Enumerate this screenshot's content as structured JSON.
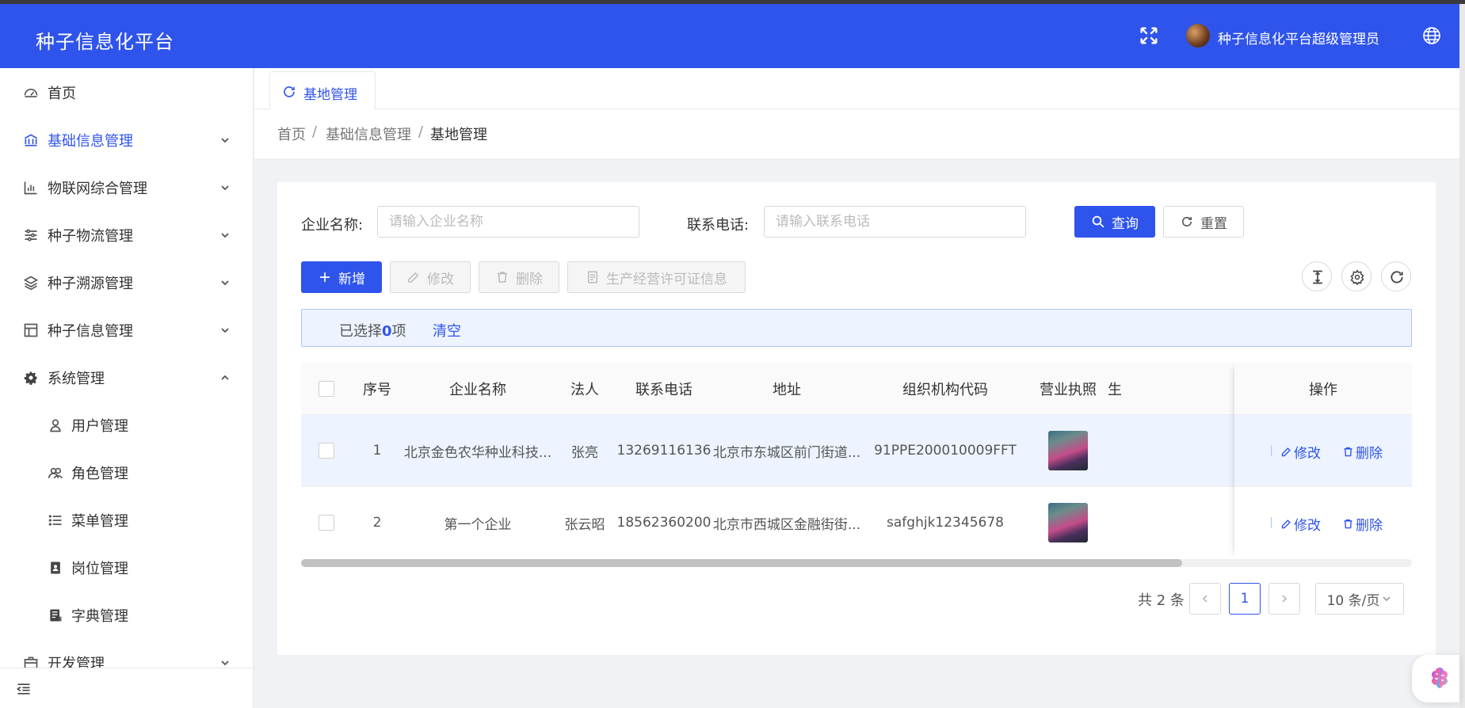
{
  "header": {
    "app_title": "种子信息化平台",
    "user_name": "种子信息化平台超级管理员",
    "icons": [
      "fullscreen-icon",
      "globe-icon"
    ]
  },
  "sidebar": {
    "items": [
      {
        "label": "首页",
        "icon": "dashboard-icon",
        "has_children": false
      },
      {
        "label": "基础信息管理",
        "icon": "bank-icon",
        "has_children": true,
        "active": true
      },
      {
        "label": "物联网综合管理",
        "icon": "bar-chart-icon",
        "has_children": true
      },
      {
        "label": "种子物流管理",
        "icon": "sliders-icon",
        "has_children": true
      },
      {
        "label": "种子溯源管理",
        "icon": "layers-icon",
        "has_children": true
      },
      {
        "label": "种子信息管理",
        "icon": "layout-icon",
        "has_children": true
      },
      {
        "label": "系统管理",
        "icon": "gear-icon",
        "has_children": true,
        "expanded": true
      },
      {
        "label": "开发管理",
        "icon": "toolbox-icon",
        "has_children": true
      }
    ],
    "system_children": [
      {
        "label": "用户管理",
        "icon": "user-icon"
      },
      {
        "label": "角色管理",
        "icon": "users-icon"
      },
      {
        "label": "菜单管理",
        "icon": "list-icon"
      },
      {
        "label": "岗位管理",
        "icon": "id-card-icon"
      },
      {
        "label": "字典管理",
        "icon": "book-icon"
      }
    ]
  },
  "tabs": [
    {
      "label": "基地管理",
      "icon": "refresh-icon"
    }
  ],
  "breadcrumb": [
    "首页",
    "基础信息管理",
    "基地管理"
  ],
  "search": {
    "company_label": "企业名称:",
    "company_placeholder": "请输入企业名称",
    "phone_label": "联系电话:",
    "phone_placeholder": "请输入联系电话",
    "query_label": "查询",
    "reset_label": "重置"
  },
  "toolbar": {
    "add_label": "新增",
    "edit_label": "修改",
    "delete_label": "删除",
    "license_label": "生产经营许可证信息"
  },
  "selection": {
    "prefix": "已选择",
    "count": "0",
    "suffix": "项",
    "clear_label": "清空"
  },
  "table": {
    "columns": [
      "序号",
      "企业名称",
      "法人",
      "联系电话",
      "地址",
      "组织机构代码",
      "营业执照",
      "生",
      "操作"
    ],
    "rows": [
      {
        "index": "1",
        "company": "北京金色农华种业科技...",
        "legal": "张亮",
        "phone": "13269116136",
        "address": "北京市东城区前门街道...",
        "org_code": "91PPE200010009FFT",
        "selected": true
      },
      {
        "index": "2",
        "company": "第一个企业",
        "legal": "张云昭",
        "phone": "18562360200",
        "address": "北京市西城区金融街街...",
        "org_code": "safghjk12345678",
        "selected": false
      }
    ],
    "row_actions": {
      "edit": "修改",
      "delete": "删除"
    }
  },
  "pagination": {
    "total_text": "共 2 条",
    "current_page": "1",
    "page_size": "10 条/页"
  },
  "colors": {
    "primary": "#2f54eb",
    "selected_row": "#edf3ff"
  }
}
